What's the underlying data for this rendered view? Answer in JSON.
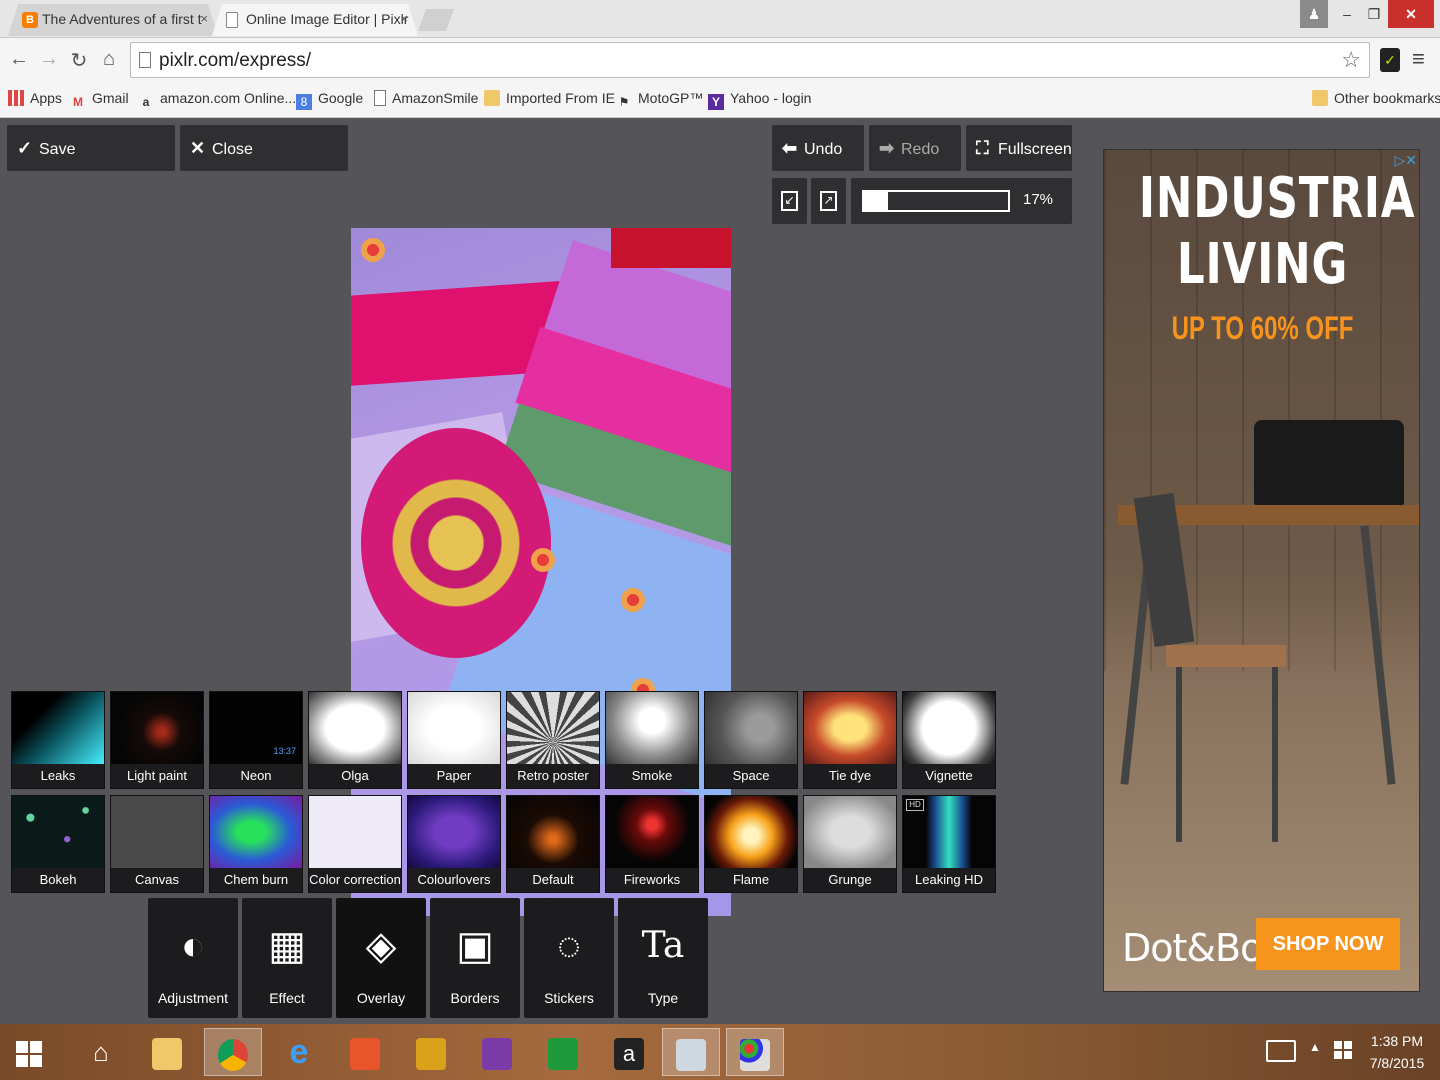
{
  "browser": {
    "tabs": [
      {
        "title": "The Adventures of a first t",
        "favicon": "B"
      },
      {
        "title": "Online Image Editor | Pixlr"
      }
    ],
    "tab_close": "×",
    "url_text": "pixlr.com/express/",
    "bookmarks": [
      {
        "label": "Apps",
        "icon": "apps-icon"
      },
      {
        "label": "Gmail",
        "icon": "gmail-icon",
        "glyph": "M"
      },
      {
        "label": "amazon.com Online...",
        "icon": "amazon-icon",
        "glyph": "a"
      },
      {
        "label": "Google",
        "icon": "google-icon",
        "glyph": "8"
      },
      {
        "label": "AmazonSmile",
        "icon": "page-icon"
      },
      {
        "label": "Imported From IE",
        "icon": "folder-icon"
      },
      {
        "label": "MotoGP™",
        "icon": "motogp-icon",
        "glyph": "⚑"
      },
      {
        "label": "Yahoo - login",
        "icon": "yahoo-icon",
        "glyph": "Y"
      }
    ],
    "other_bookmarks": "Other bookmarks"
  },
  "editor": {
    "save_label": "Save",
    "close_label": "Close",
    "undo_label": "Undo",
    "redo_label": "Redo",
    "fullscreen_label": "Fullscreen",
    "zoom_percent": 17,
    "zoom_label": "17%",
    "overlays_row1": [
      {
        "label": "Leaks",
        "thumb": "leaks"
      },
      {
        "label": "Light paint",
        "thumb": "lightpaint"
      },
      {
        "label": "Neon",
        "thumb": "neon",
        "clock": "13:37"
      },
      {
        "label": "Olga",
        "thumb": "olga"
      },
      {
        "label": "Paper",
        "thumb": "paper"
      },
      {
        "label": "Retro poster",
        "thumb": "retro"
      },
      {
        "label": "Smoke",
        "thumb": "smoke"
      },
      {
        "label": "Space",
        "thumb": "space"
      },
      {
        "label": "Tie dye",
        "thumb": "tiedye"
      },
      {
        "label": "Vignette",
        "thumb": "vignette"
      }
    ],
    "overlays_row2": [
      {
        "label": "Bokeh",
        "thumb": "bokeh"
      },
      {
        "label": "Canvas",
        "thumb": "canvas"
      },
      {
        "label": "Chem burn",
        "thumb": "chemburn"
      },
      {
        "label": "Color correction",
        "thumb": "colorcorr"
      },
      {
        "label": "Colourlovers",
        "thumb": "colourlovers"
      },
      {
        "label": "Default",
        "thumb": "default"
      },
      {
        "label": "Fireworks",
        "thumb": "fireworks"
      },
      {
        "label": "Flame",
        "thumb": "flame"
      },
      {
        "label": "Grunge",
        "thumb": "grunge"
      },
      {
        "label": "Leaking HD",
        "thumb": "leakinghd",
        "badge": "HD"
      }
    ],
    "tools": [
      {
        "label": "Adjustment",
        "icon": "adjustment-icon",
        "glyph": "◐"
      },
      {
        "label": "Effect",
        "icon": "film-icon",
        "glyph": "▦"
      },
      {
        "label": "Overlay",
        "icon": "layers-icon",
        "glyph": "◈",
        "active": true
      },
      {
        "label": "Borders",
        "icon": "border-icon",
        "glyph": "▣"
      },
      {
        "label": "Stickers",
        "icon": "sticker-icon",
        "glyph": "◌"
      },
      {
        "label": "Type",
        "icon": "type-icon",
        "glyph": "Ta"
      }
    ]
  },
  "ad": {
    "title_line1": "INDUSTRIAL",
    "title_line2": "LIVING",
    "subtitle": "UP TO 60% OFF",
    "logo": "Dot&Bo",
    "cta": "SHOP NOW",
    "accent_color": "#f7941d"
  },
  "taskbar": {
    "apps": [
      "home-icon",
      "file-explorer-icon",
      "chrome-icon",
      "internet-explorer-icon",
      "photos-icon",
      "notes-icon",
      "onenote-icon",
      "excel-icon",
      "amazon-icon",
      "monitor-icon",
      "paint-icon"
    ],
    "time": "1:38 PM",
    "date": "7/8/2015"
  }
}
